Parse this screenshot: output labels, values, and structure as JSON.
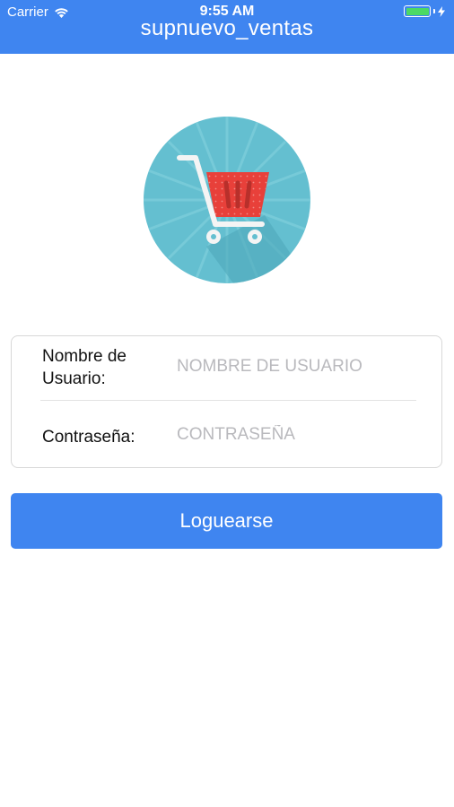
{
  "status_bar": {
    "carrier": "Carrier",
    "time": "9:55 AM",
    "battery_color": "#4cd964"
  },
  "nav": {
    "title": "supnuevo_ventas",
    "background": "#3f85f0"
  },
  "logo": {
    "icon": "shopping-cart-icon",
    "circle_color": "#64bfd0",
    "cart_color": "#e8403a"
  },
  "form": {
    "username": {
      "label": "Nombre de Usuario:",
      "placeholder": "NOMBRE DE USUARIO",
      "value": ""
    },
    "password": {
      "label": "Contraseña:",
      "placeholder": "CONTRASEÑA",
      "value": ""
    }
  },
  "login_button": {
    "label": "Loguearse"
  }
}
